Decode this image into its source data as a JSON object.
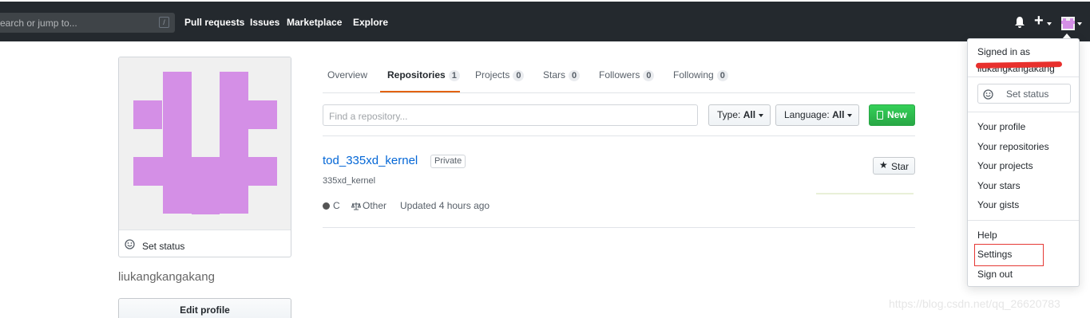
{
  "header": {
    "search_placeholder": "earch or jump to...",
    "search_shortcut": "/",
    "nav": [
      "Pull requests",
      "Issues",
      "Marketplace",
      "Explore"
    ],
    "icons": [
      "bell-icon",
      "plus-icon",
      "avatar"
    ]
  },
  "profile": {
    "set_status": "Set status",
    "username": "liukangkangakang",
    "edit_profile": "Edit profile",
    "avatar_color": "#d48fe6"
  },
  "tabs": [
    {
      "label": "Overview",
      "count": null
    },
    {
      "label": "Repositories",
      "count": "1"
    },
    {
      "label": "Projects",
      "count": "0"
    },
    {
      "label": "Stars",
      "count": "0"
    },
    {
      "label": "Followers",
      "count": "0"
    },
    {
      "label": "Following",
      "count": "0"
    }
  ],
  "filters": {
    "search_placeholder": "Find a repository...",
    "type_label": "Type:",
    "type_value": "All",
    "language_label": "Language:",
    "language_value": "All",
    "new_label": "New"
  },
  "repo": {
    "name": "tod_335xd_kernel",
    "visibility": "Private",
    "description": "335xd_kernel",
    "language": "C",
    "license": "Other",
    "updated": "Updated 4 hours ago",
    "star_label": "Star"
  },
  "dropdown": {
    "signed_in_as": "Signed in as",
    "user_redacted": "liukangkangakang",
    "set_status": "Set status",
    "items_group1": [
      "Your profile",
      "Your repositories",
      "Your projects",
      "Your stars",
      "Your gists"
    ],
    "help": "Help",
    "settings": "Settings",
    "sign_out": "Sign out"
  },
  "watermark": "https://blog.csdn.net/qq_26620783",
  "colors": {
    "header_bg": "#24292e",
    "accent_orange": "#e36209",
    "link_blue": "#0366d6",
    "new_green": "#28a745",
    "highlight_red": "#e53935"
  }
}
